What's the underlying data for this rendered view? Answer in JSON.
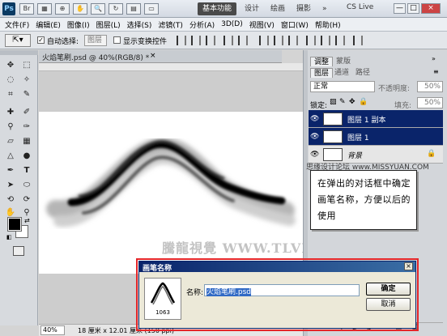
{
  "titlebar": {
    "logo": "Ps",
    "workspace_buttons": [
      "基本功能",
      "设计",
      "绘画",
      "摄影"
    ],
    "workspace_more": "»",
    "cslive": "CS Live",
    "window_controls": [
      "—",
      "□",
      "×"
    ]
  },
  "menu": [
    "文件(F)",
    "编辑(E)",
    "图像(I)",
    "图层(L)",
    "选择(S)",
    "滤镜(T)",
    "分析(A)",
    "3D(D)",
    "视图(V)",
    "窗口(W)",
    "帮助(H)"
  ],
  "options": {
    "auto_select_label": "自动选择:",
    "auto_select_value": "图层",
    "show_transform_label": "显示变换控件",
    "auto_select_checked": "✓"
  },
  "document": {
    "tab_label": "火焰笔刷.psd @ 40%(RGB/8) *",
    "close": "×",
    "zoom": "40%",
    "info": "18 厘米 x 12.01 厘米 (150 ppi)"
  },
  "panels": {
    "top_tabs": [
      "调整",
      "蒙版"
    ],
    "layer_tabs": [
      "图层",
      "通道",
      "路径"
    ],
    "blend_mode": "正常",
    "opacity_label": "不透明度:",
    "opacity_value": "50%",
    "lock_label": "锁定:",
    "fill_label": "填充:",
    "fill_value": "50%",
    "layers": [
      {
        "name": "图层 1 副本",
        "selected": true
      },
      {
        "name": "图层 1",
        "selected": true
      },
      {
        "name": "背景",
        "selected": false
      }
    ]
  },
  "callout": {
    "tag": "思缘设计论坛 www.MISSYUAN.COM",
    "text": "在弹出的对话框中确定画笔名称，方便以后的使用"
  },
  "watermark": "騰龍視覺 WWW.TLVI.NET",
  "dialog": {
    "title": "画笔名称",
    "brush_size": "1063",
    "name_label": "名称:",
    "name_value": "火焰笔刷.psd",
    "ok": "确定",
    "cancel": "取消",
    "close": "×"
  },
  "colors": {
    "accent": "#0a246a",
    "highlight_border": "#e42629"
  }
}
